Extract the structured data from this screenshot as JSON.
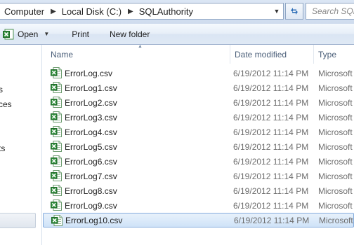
{
  "address": {
    "crumbs": [
      "Computer",
      "Local Disk (C:)",
      "SQLAuthority"
    ]
  },
  "search": {
    "placeholder": "Search SQL"
  },
  "toolbar": {
    "open_label": "Open",
    "print_label": "Print",
    "new_folder_label": "New folder"
  },
  "nav": {
    "items": [
      "s",
      "ces",
      "ts"
    ]
  },
  "columns": {
    "name": "Name",
    "date": "Date modified",
    "type": "Type"
  },
  "files": [
    {
      "name": "ErrorLog.csv",
      "date": "6/19/2012 11:14 PM",
      "type": "Microsoft"
    },
    {
      "name": "ErrorLog1.csv",
      "date": "6/19/2012 11:14 PM",
      "type": "Microsoft"
    },
    {
      "name": "ErrorLog2.csv",
      "date": "6/19/2012 11:14 PM",
      "type": "Microsoft"
    },
    {
      "name": "ErrorLog3.csv",
      "date": "6/19/2012 11:14 PM",
      "type": "Microsoft"
    },
    {
      "name": "ErrorLog4.csv",
      "date": "6/19/2012 11:14 PM",
      "type": "Microsoft"
    },
    {
      "name": "ErrorLog5.csv",
      "date": "6/19/2012 11:14 PM",
      "type": "Microsoft"
    },
    {
      "name": "ErrorLog6.csv",
      "date": "6/19/2012 11:14 PM",
      "type": "Microsoft"
    },
    {
      "name": "ErrorLog7.csv",
      "date": "6/19/2012 11:14 PM",
      "type": "Microsoft"
    },
    {
      "name": "ErrorLog8.csv",
      "date": "6/19/2012 11:14 PM",
      "type": "Microsoft"
    },
    {
      "name": "ErrorLog9.csv",
      "date": "6/19/2012 11:14 PM",
      "type": "Microsoft"
    },
    {
      "name": "ErrorLog10.csv",
      "date": "6/19/2012 11:14 PM",
      "type": "Microsoft"
    }
  ],
  "selected_index": 10,
  "icons": {
    "file": "excel-csv-file-icon",
    "refresh": "refresh-icon",
    "open": "excel-icon"
  },
  "colors": {
    "excel_green": "#2e8b3a",
    "selection": "#cfe3f8"
  }
}
